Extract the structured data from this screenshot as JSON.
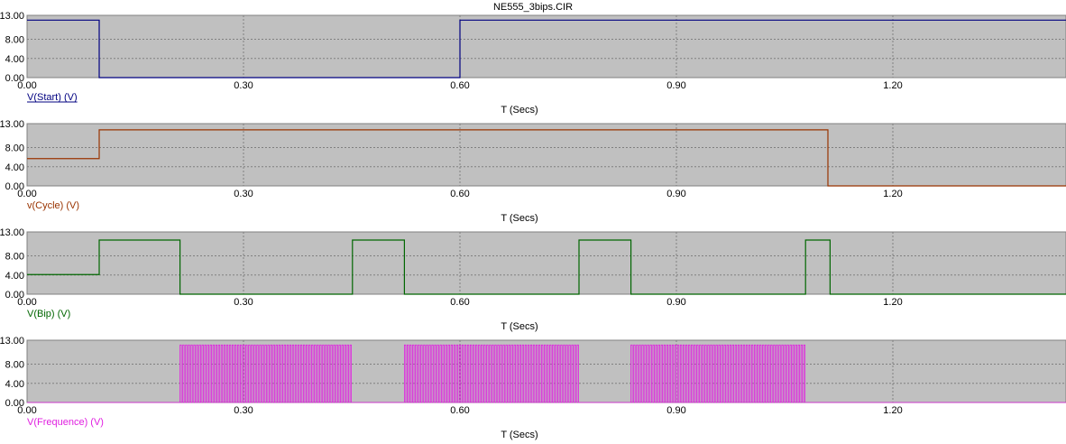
{
  "window": {
    "title": "NE555_3bips.CIR"
  },
  "colors": {
    "plot_bg": "#c0c0c0",
    "grid": "#808080",
    "start": "#000080",
    "cycle": "#993300",
    "bip": "#006600",
    "freq": "#e020e0"
  },
  "chart_data": [
    {
      "type": "line",
      "ylabel": "V(Start) (V)",
      "xlabel": "T (Secs)",
      "xlim": [
        0,
        1.44
      ],
      "ylim": [
        0,
        13
      ],
      "xticks": [
        "0.00",
        "0.30",
        "0.60",
        "0.90",
        "1.20"
      ],
      "yticks": [
        "0.00",
        "4.00",
        "8.00",
        "13.00"
      ],
      "series": [
        {
          "name": "V(Start) (V)",
          "color": "#000080",
          "x": [
            0,
            0.1,
            0.1,
            0.6,
            0.6,
            1.44
          ],
          "y": [
            12,
            12,
            0,
            0,
            12,
            12
          ]
        }
      ]
    },
    {
      "type": "line",
      "ylabel": "v(Cycle) (V)",
      "xlabel": "T (Secs)",
      "xlim": [
        0,
        1.44
      ],
      "ylim": [
        0,
        13
      ],
      "xticks": [
        "0.00",
        "0.30",
        "0.60",
        "0.90",
        "1.20"
      ],
      "yticks": [
        "0.00",
        "4.00",
        "8.00",
        "13.00"
      ],
      "series": [
        {
          "name": "v(Cycle) (V)",
          "color": "#993300",
          "x": [
            0,
            0.1,
            0.1,
            1.11,
            1.11,
            1.44
          ],
          "y": [
            5.7,
            5.7,
            11.7,
            11.7,
            0,
            0
          ]
        }
      ]
    },
    {
      "type": "line",
      "ylabel": "V(Bip) (V)",
      "xlabel": "T (Secs)",
      "xlim": [
        0,
        1.44
      ],
      "ylim": [
        0,
        13
      ],
      "xticks": [
        "0.00",
        "0.30",
        "0.60",
        "0.90",
        "1.20"
      ],
      "yticks": [
        "0.00",
        "4.00",
        "8.00",
        "13.00"
      ],
      "series": [
        {
          "name": "V(Bip) (V)",
          "color": "#006600",
          "x": [
            0,
            0.1,
            0.1,
            0.212,
            0.212,
            0.451,
            0.451,
            0.523,
            0.523,
            0.765,
            0.765,
            0.837,
            0.837,
            1.079,
            1.079,
            1.113,
            1.113,
            1.44
          ],
          "y": [
            4.1,
            4.1,
            11.3,
            11.3,
            0,
            0,
            11.3,
            11.3,
            0,
            0,
            11.3,
            11.3,
            0,
            0,
            11.3,
            11.3,
            0,
            0
          ]
        }
      ]
    },
    {
      "type": "line",
      "ylabel": "V(Frequence) (V)",
      "xlabel": "T (Secs)",
      "xlim": [
        0,
        1.44
      ],
      "ylim": [
        0,
        13
      ],
      "xticks": [
        "0.00",
        "0.30",
        "0.60",
        "0.90",
        "1.20"
      ],
      "yticks": [
        "0.00",
        "4.00",
        "8.00",
        "13.00"
      ],
      "series": [
        {
          "name": "V(Frequence) (V)",
          "color": "#e020e0",
          "bursts": [
            [
              0.212,
              0.451
            ],
            [
              0.523,
              0.765
            ],
            [
              0.837,
              1.079
            ]
          ],
          "period": 0.0038,
          "high": 12,
          "low": 0
        }
      ]
    }
  ]
}
